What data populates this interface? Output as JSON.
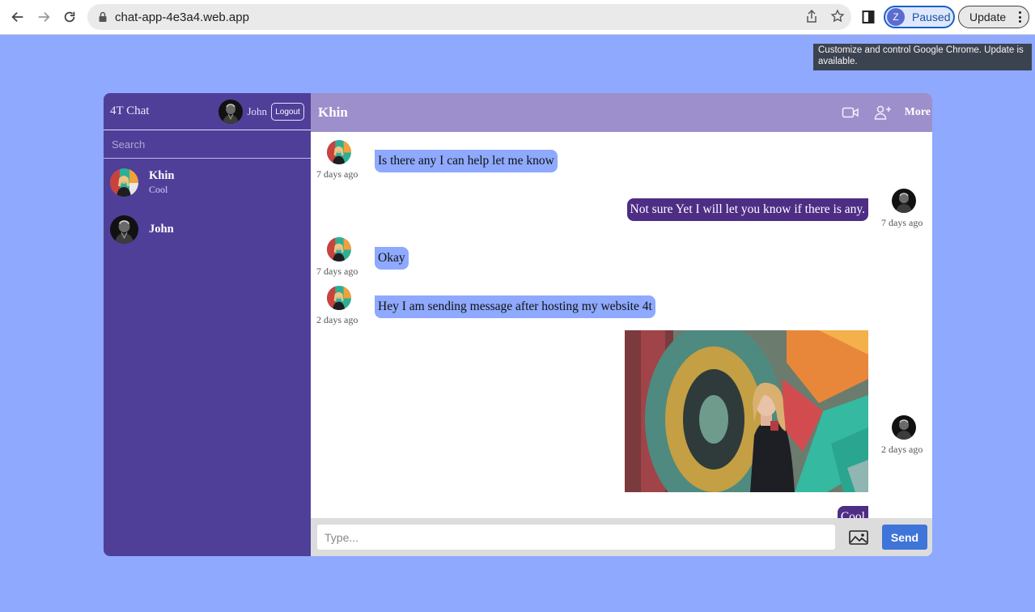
{
  "browser": {
    "url": "chat-app-4e3a4.web.app",
    "profile_initial": "Z",
    "profile_status": "Paused",
    "update_label": "Update",
    "tooltip": "Customize and control Google Chrome. Update is available."
  },
  "sidebar": {
    "brand": "4T Chat",
    "current_user": "John",
    "logout_label": "Logout",
    "search_placeholder": "Search",
    "contacts": [
      {
        "name": "Khin",
        "last_message": "Cool"
      },
      {
        "name": "John",
        "last_message": ""
      }
    ]
  },
  "chat": {
    "title": "Khin",
    "more_label": "More",
    "messages": [
      {
        "from": "Khin",
        "direction": "incoming",
        "text": "Is there any I can help let me know",
        "time": "7 days ago"
      },
      {
        "from": "John",
        "direction": "outgoing",
        "text": "Not sure Yet I will let you know if there is any.",
        "time": "7 days ago"
      },
      {
        "from": "Khin",
        "direction": "incoming",
        "text": "Okay",
        "time": "7 days ago"
      },
      {
        "from": "Khin",
        "direction": "incoming",
        "text": "Hey I am sending message after hosting my website 4t",
        "time": "2 days ago"
      },
      {
        "from": "John",
        "direction": "outgoing",
        "type": "image",
        "time": "2 days ago"
      },
      {
        "from": "John",
        "direction": "outgoing",
        "text": "Cool",
        "time": ""
      }
    ],
    "composer_placeholder": "Type...",
    "send_label": "Send"
  },
  "colors": {
    "page_background": "#8ea9fd",
    "sidebar": "#4f3f98",
    "chat_header": "#9d8fcb",
    "incoming_bubble": "#8ea9fd",
    "outgoing_bubble": "#4e2d85",
    "send_button": "#3f74d8"
  }
}
